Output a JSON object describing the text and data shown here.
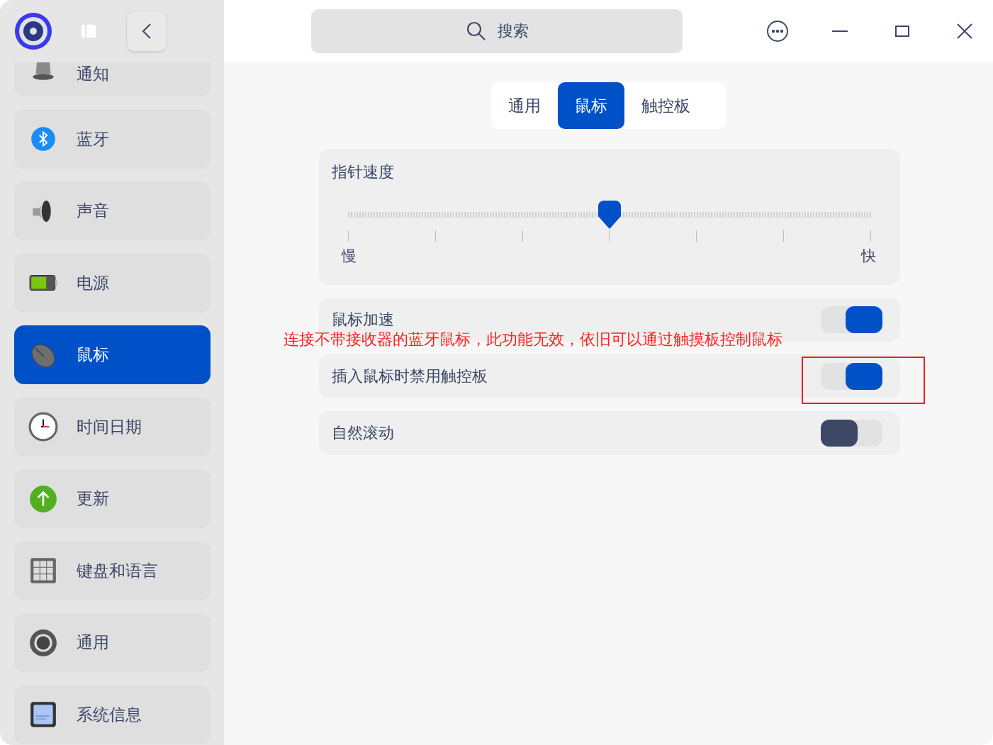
{
  "sidebar": {
    "items": [
      {
        "label": "通知",
        "kind": "bell",
        "selected": false
      },
      {
        "label": "蓝牙",
        "kind": "bluetooth",
        "selected": false
      },
      {
        "label": "声音",
        "kind": "speaker",
        "selected": false
      },
      {
        "label": "电源",
        "kind": "battery",
        "selected": false
      },
      {
        "label": "鼠标",
        "kind": "mouse",
        "selected": true
      },
      {
        "label": "时间日期",
        "kind": "clock",
        "selected": false
      },
      {
        "label": "更新",
        "kind": "update",
        "selected": false
      },
      {
        "label": "键盘和语言",
        "kind": "keyboard",
        "selected": false
      },
      {
        "label": "通用",
        "kind": "gear",
        "selected": false
      },
      {
        "label": "系统信息",
        "kind": "chip",
        "selected": false
      }
    ]
  },
  "search": {
    "placeholder": "搜索"
  },
  "tabs": [
    {
      "label": "通用",
      "selected": false
    },
    {
      "label": "鼠标",
      "selected": true
    },
    {
      "label": "触控板",
      "selected": false
    }
  ],
  "pointer_speed": {
    "title": "指针速度",
    "level": 0.5,
    "min_label": "慢",
    "max_label": "快"
  },
  "toggles": [
    {
      "label": "鼠标加速",
      "on": true
    },
    {
      "label": "插入鼠标时禁用触控板",
      "on": true
    },
    {
      "label": "自然滚动",
      "on": false
    }
  ],
  "annotation": {
    "text": "连接不带接收器的蓝牙鼠标，此功能无效，依旧可以通过触摸板控制鼠标"
  }
}
